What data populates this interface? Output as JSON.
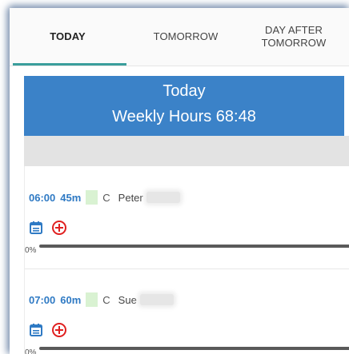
{
  "tabs": [
    {
      "label": "TODAY",
      "selected": true
    },
    {
      "label": "TOMORROW",
      "selected": false
    },
    {
      "label": "DAY AFTER\nTOMORROW",
      "selected": false
    }
  ],
  "banner": {
    "title": "Today",
    "weekly_hours": "Weekly Hours 68:48"
  },
  "appointments": [
    {
      "time": "06:00",
      "duration": "45m",
      "code": "C",
      "name": "Peter",
      "progress": "0%"
    },
    {
      "time": "07:00",
      "duration": "60m",
      "code": "C",
      "name": "Sue",
      "progress": "0%"
    }
  ],
  "colors": {
    "accent": "#3a9e9c",
    "banner": "#3b82c8",
    "time": "#2f7ac4",
    "add_icon": "#e02020"
  },
  "icons": {
    "calendar": "calendar-icon",
    "add": "add-circle-icon"
  }
}
